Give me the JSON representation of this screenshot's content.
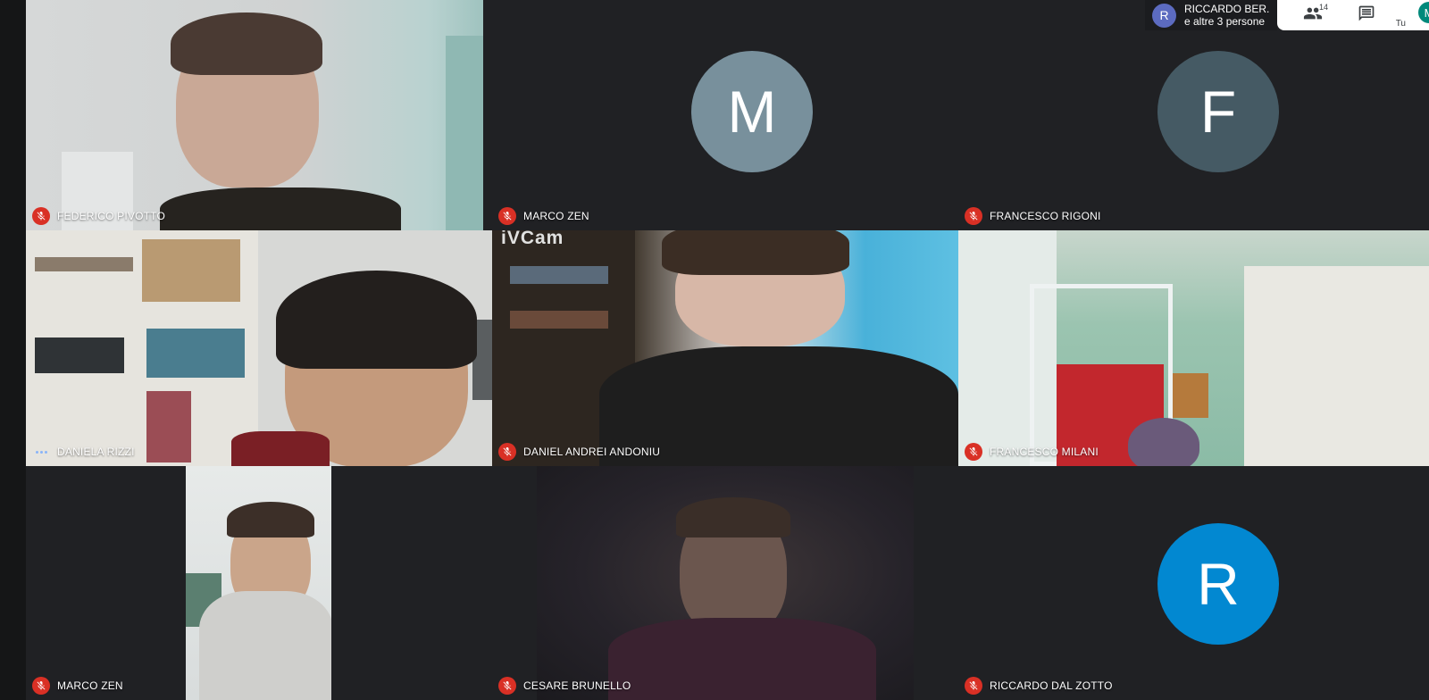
{
  "header": {
    "presenter_initial": "R",
    "presenter_name": "RICCARDO BER...",
    "presenter_sub": "e altre 3 persone",
    "participants_count": "14",
    "self_initial": "M",
    "self_label": "Tu"
  },
  "watermark_text": "iVCam",
  "participants": [
    {
      "name": "FEDERICO PIVOTTO",
      "muted": true
    },
    {
      "name": "MARCO ZEN",
      "muted": true,
      "initial": "M",
      "avatar_color": "#78909c"
    },
    {
      "name": "FRANCESCO RIGONI",
      "muted": true,
      "initial": "F",
      "avatar_color": "#455a64"
    },
    {
      "name": "DANIELA RIZZI",
      "muted": false
    },
    {
      "name": "DANIEL ANDREI ANDONIU",
      "muted": true
    },
    {
      "name": "FRANCESCO MILANI",
      "muted": true
    },
    {
      "name": "MARCO ZEN",
      "muted": true
    },
    {
      "name": "CESARE BRUNELLO",
      "muted": true
    },
    {
      "name": "RICCARDO DAL ZOTTO",
      "muted": true,
      "initial": "R",
      "avatar_color": "#0288d1"
    }
  ],
  "icons": {
    "mic_off": "mic-off-icon",
    "speaking": "speaking-indicator-icon",
    "people": "people-icon",
    "chat": "chat-icon"
  }
}
